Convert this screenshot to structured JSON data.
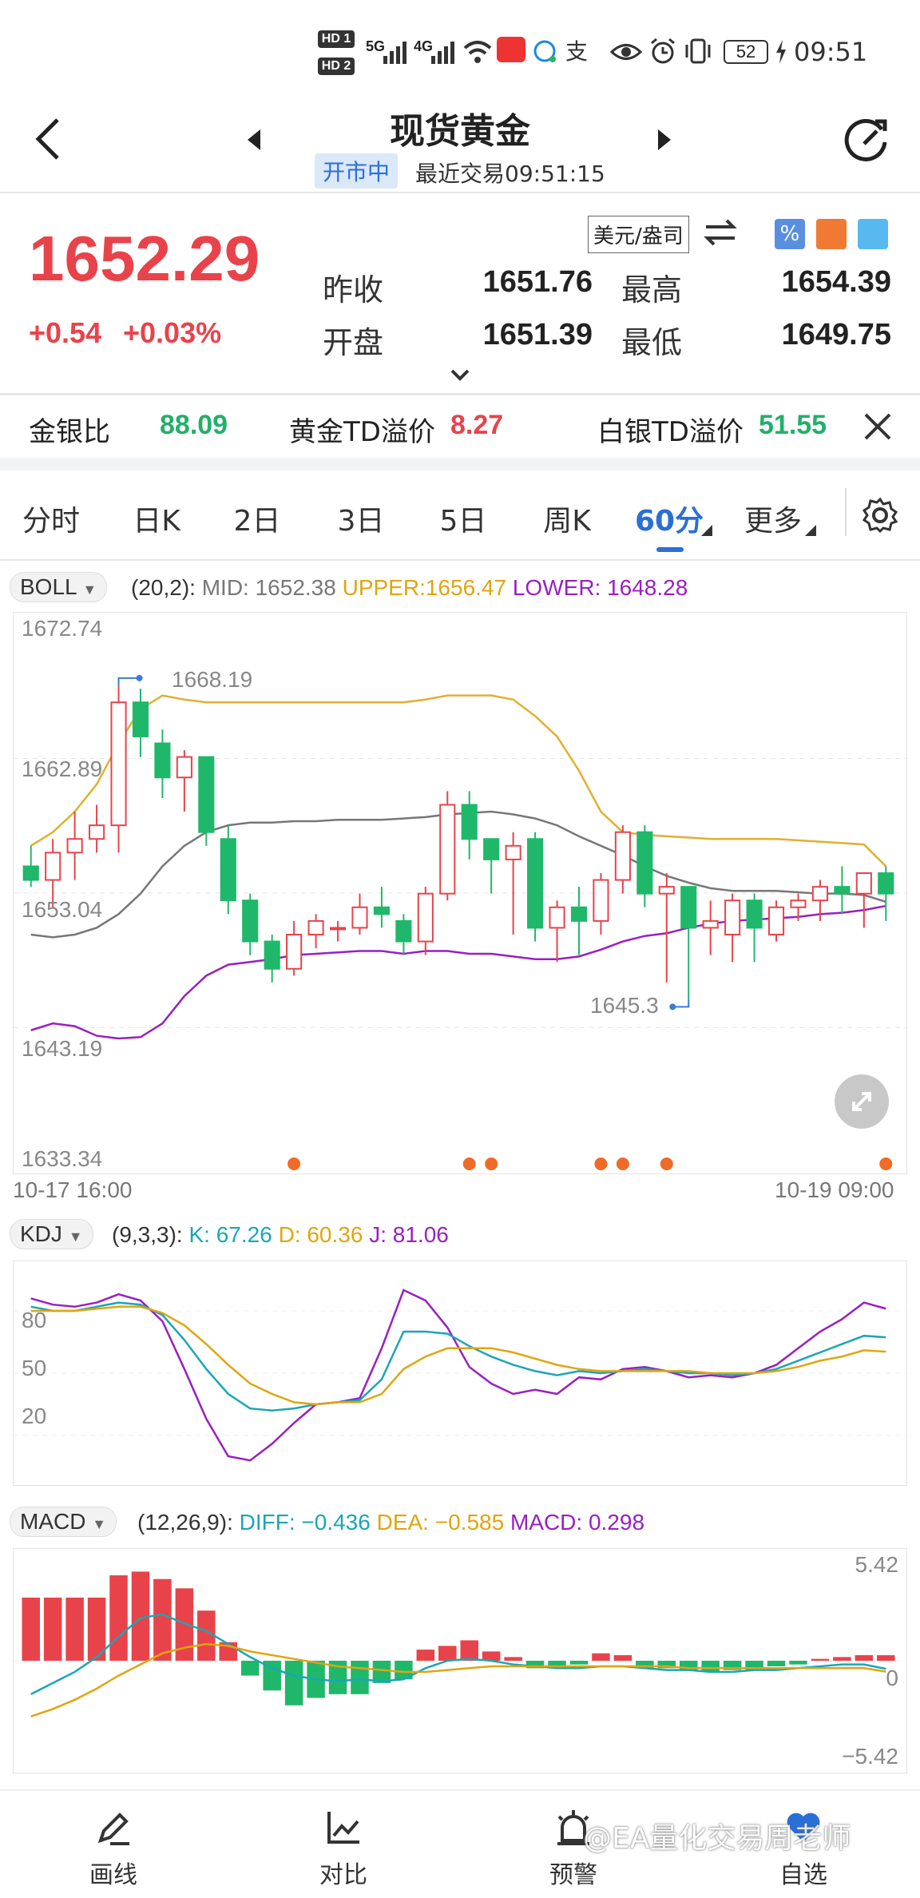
{
  "status_bar": {
    "hd1": "HD 1",
    "hd2": "HD 2",
    "net1": "5G",
    "net2": "4G",
    "battery": "52",
    "time": "09:51"
  },
  "header": {
    "title": "现货黄金",
    "status_badge": "开市中",
    "last_trade": "最近交易09:51:15"
  },
  "quote": {
    "price": "1652.29",
    "change": "+0.54",
    "change_pct": "+0.03%",
    "currency_unit": "美元/盎司",
    "fields": [
      {
        "label": "昨收",
        "value": "1651.76"
      },
      {
        "label": "最高",
        "value": "1654.39"
      },
      {
        "label": "开盘",
        "value": "1651.39"
      },
      {
        "label": "最低",
        "value": "1649.75"
      }
    ]
  },
  "ratios": {
    "gold_silver_label": "金银比",
    "gold_silver_value": "88.09",
    "gold_td_label": "黄金TD溢价",
    "gold_td_value": "8.27",
    "silver_td_label": "白银TD溢价",
    "silver_td_value": "51.55"
  },
  "tabs": [
    "分时",
    "日K",
    "2日",
    "3日",
    "5日",
    "周K",
    "60分",
    "更多"
  ],
  "active_tab": "60分",
  "boll": {
    "name": "BOLL",
    "params": "(20,2):",
    "mid": "MID: 1652.38",
    "upper": "UPPER:1656.47",
    "lower": "LOWER: 1648.28"
  },
  "kdj": {
    "name": "KDJ",
    "params": "(9,3,3):",
    "k": "K: 67.26",
    "d": "D: 60.36",
    "j": "J: 81.06",
    "y_ticks": [
      "80",
      "50",
      "20"
    ]
  },
  "macd": {
    "name": "MACD",
    "params": "(12,26,9):",
    "diff": "DIFF: −0.436",
    "dea": "DEA: −0.585",
    "macd": "MACD: 0.298",
    "y_top": "5.42",
    "y_mid": "0",
    "y_bottom": "−5.42"
  },
  "colors": {
    "up": "#e8434b",
    "down": "#1fb86a",
    "accent": "#2a6fd6",
    "upper_band": "#e0b030",
    "lower_band": "#9a1fc0",
    "mid_band": "#777777"
  },
  "chart_data": {
    "type": "candlestick",
    "title": "",
    "y_ticks": [
      "1672.74",
      "1662.89",
      "1653.04",
      "1643.19",
      "1633.34"
    ],
    "ylim": [
      1633.34,
      1672.74
    ],
    "x_start_label": "10-17 16:00",
    "x_end_label": "10-19 09:00",
    "max_annotation": "1668.19",
    "min_annotation": "1645.3",
    "candles": [
      {
        "o": 1655.0,
        "h": 1656.5,
        "l": 1653.5,
        "c": 1654.0
      },
      {
        "o": 1654.0,
        "h": 1657.0,
        "l": 1652.0,
        "c": 1656.0
      },
      {
        "o": 1656.0,
        "h": 1659.0,
        "l": 1654.0,
        "c": 1657.0
      },
      {
        "o": 1657.0,
        "h": 1659.5,
        "l": 1656.0,
        "c": 1658.0
      },
      {
        "o": 1658.0,
        "h": 1668.19,
        "l": 1656.0,
        "c": 1667.0
      },
      {
        "o": 1667.0,
        "h": 1668.0,
        "l": 1663.0,
        "c": 1664.5
      },
      {
        "o": 1664.0,
        "h": 1665.0,
        "l": 1660.0,
        "c": 1661.5
      },
      {
        "o": 1661.5,
        "h": 1663.5,
        "l": 1659.0,
        "c": 1663.0
      },
      {
        "o": 1663.0,
        "h": 1663.0,
        "l": 1656.5,
        "c": 1657.5
      },
      {
        "o": 1657.0,
        "h": 1658.0,
        "l": 1651.5,
        "c": 1652.5
      },
      {
        "o": 1652.5,
        "h": 1653.0,
        "l": 1648.5,
        "c": 1649.5
      },
      {
        "o": 1649.5,
        "h": 1650.0,
        "l": 1646.5,
        "c": 1647.5
      },
      {
        "o": 1647.5,
        "h": 1651.0,
        "l": 1647.0,
        "c": 1650.0
      },
      {
        "o": 1650.0,
        "h": 1651.5,
        "l": 1649.0,
        "c": 1651.0
      },
      {
        "o": 1650.5,
        "h": 1651.0,
        "l": 1649.5,
        "c": 1650.5
      },
      {
        "o": 1650.5,
        "h": 1653.0,
        "l": 1650.0,
        "c": 1652.0
      },
      {
        "o": 1652.0,
        "h": 1653.5,
        "l": 1650.5,
        "c": 1651.5
      },
      {
        "o": 1651.0,
        "h": 1651.5,
        "l": 1648.5,
        "c": 1649.5
      },
      {
        "o": 1649.5,
        "h": 1653.5,
        "l": 1648.5,
        "c": 1653.0
      },
      {
        "o": 1653.0,
        "h": 1660.5,
        "l": 1652.5,
        "c": 1659.5
      },
      {
        "o": 1659.5,
        "h": 1660.5,
        "l": 1655.5,
        "c": 1657.0
      },
      {
        "o": 1657.0,
        "h": 1657.0,
        "l": 1653.0,
        "c": 1655.5
      },
      {
        "o": 1655.5,
        "h": 1657.5,
        "l": 1650.0,
        "c": 1656.5
      },
      {
        "o": 1657.0,
        "h": 1657.5,
        "l": 1649.5,
        "c": 1650.5
      },
      {
        "o": 1650.5,
        "h": 1652.5,
        "l": 1648.0,
        "c": 1652.0
      },
      {
        "o": 1652.0,
        "h": 1653.5,
        "l": 1648.5,
        "c": 1651.0
      },
      {
        "o": 1651.0,
        "h": 1654.5,
        "l": 1650.0,
        "c": 1654.0
      },
      {
        "o": 1654.0,
        "h": 1658.0,
        "l": 1653.0,
        "c": 1657.5
      },
      {
        "o": 1657.5,
        "h": 1658.0,
        "l": 1652.0,
        "c": 1653.0
      },
      {
        "o": 1653.0,
        "h": 1654.5,
        "l": 1646.5,
        "c": 1653.5
      },
      {
        "o": 1653.5,
        "h": 1653.5,
        "l": 1645.3,
        "c": 1650.5
      },
      {
        "o": 1650.5,
        "h": 1652.5,
        "l": 1648.5,
        "c": 1651.0
      },
      {
        "o": 1650.0,
        "h": 1653.0,
        "l": 1648.0,
        "c": 1652.5
      },
      {
        "o": 1652.5,
        "h": 1653.0,
        "l": 1648.0,
        "c": 1650.5
      },
      {
        "o": 1650.0,
        "h": 1652.5,
        "l": 1649.5,
        "c": 1652.0
      },
      {
        "o": 1652.0,
        "h": 1653.0,
        "l": 1651.0,
        "c": 1652.5
      },
      {
        "o": 1652.5,
        "h": 1654.0,
        "l": 1651.0,
        "c": 1653.5
      },
      {
        "o": 1653.5,
        "h": 1655.0,
        "l": 1651.5,
        "c": 1653.0
      },
      {
        "o": 1653.0,
        "h": 1654.5,
        "l": 1650.5,
        "c": 1654.5
      },
      {
        "o": 1654.5,
        "h": 1655.0,
        "l": 1651.0,
        "c": 1653.0
      }
    ],
    "upper": [
      1656.5,
      1657.5,
      1659,
      1661,
      1664,
      1666.5,
      1667.5,
      1667.2,
      1667,
      1667,
      1667,
      1667,
      1667,
      1667,
      1667,
      1667,
      1667,
      1667,
      1667.2,
      1667.5,
      1667.5,
      1667.5,
      1667.2,
      1666,
      1664.5,
      1662,
      1659,
      1657.5,
      1657.3,
      1657.2,
      1657.1,
      1657,
      1657,
      1657,
      1657,
      1656.9,
      1656.8,
      1656.7,
      1656.6,
      1655
    ],
    "mid": [
      1650,
      1649.8,
      1650,
      1650.5,
      1651.5,
      1653,
      1655,
      1656.5,
      1657.5,
      1658,
      1658.2,
      1658.2,
      1658.3,
      1658.3,
      1658.4,
      1658.4,
      1658.4,
      1658.5,
      1658.6,
      1658.8,
      1658.9,
      1659,
      1658.8,
      1658.5,
      1658,
      1657.2,
      1656.5,
      1655.8,
      1655,
      1654.3,
      1653.8,
      1653.4,
      1653.2,
      1653.2,
      1653.2,
      1653.1,
      1653,
      1653,
      1652.9,
      1652.4
    ],
    "lower": [
      1643,
      1643.5,
      1643.3,
      1642.6,
      1642.4,
      1642.5,
      1643.5,
      1645.5,
      1647,
      1647.8,
      1648,
      1648.2,
      1648.5,
      1648.6,
      1648.7,
      1648.8,
      1648.8,
      1648.6,
      1648.8,
      1648.8,
      1648.6,
      1648.6,
      1648.4,
      1648.2,
      1648.2,
      1648.4,
      1648.9,
      1649.5,
      1649.9,
      1650.1,
      1650.5,
      1650.8,
      1651,
      1651.1,
      1651.2,
      1651.3,
      1651.5,
      1651.6,
      1651.8,
      1652.1
    ],
    "markers": [
      12,
      20,
      21,
      26,
      27,
      29,
      39
    ],
    "kdj_range": [
      0,
      100
    ],
    "kdj_k": [
      82,
      80,
      80,
      82,
      84,
      83,
      78,
      66,
      52,
      40,
      33,
      32,
      33,
      35,
      36,
      37,
      47,
      70,
      70,
      69,
      63,
      58,
      54,
      51,
      49,
      51,
      50,
      51,
      52,
      51,
      50,
      50,
      49,
      50,
      52,
      56,
      60,
      64,
      68,
      67.26
    ],
    "kdj_d": [
      80,
      80,
      80,
      81,
      82,
      82,
      79,
      73,
      64,
      54,
      45,
      40,
      36,
      35,
      36,
      36,
      40,
      52,
      58,
      62,
      62,
      62,
      60,
      57,
      54,
      52,
      51,
      51,
      51,
      51,
      51,
      50,
      50,
      50,
      51,
      53,
      56,
      58,
      61,
      60.36
    ],
    "kdj_j": [
      86,
      83,
      82,
      84,
      88,
      85,
      75,
      52,
      28,
      10,
      8,
      16,
      26,
      35,
      36,
      38,
      62,
      90,
      85,
      72,
      53,
      45,
      40,
      42,
      40,
      48,
      47,
      52,
      53,
      51,
      48,
      49,
      48,
      50,
      54,
      62,
      70,
      76,
      84,
      81.06
    ],
    "macd_range": [
      -5.42,
      5.42
    ],
    "macd_hist": [
      3.4,
      3.4,
      3.4,
      3.4,
      4.6,
      4.8,
      4.4,
      3.9,
      2.7,
      1.0,
      -0.8,
      -1.6,
      -2.4,
      -2.0,
      -1.8,
      -1.8,
      -1.2,
      -1.0,
      0.6,
      0.8,
      1.1,
      0.5,
      0.2,
      -0.4,
      -0.3,
      -0.2,
      0.4,
      0.3,
      -0.4,
      -0.4,
      -0.5,
      -0.6,
      -0.5,
      -0.5,
      -0.3,
      -0.2,
      0.1,
      0.2,
      0.3,
      0.298
    ],
    "macd_diff": [
      -1.8,
      -1.2,
      -0.6,
      0.2,
      1.3,
      2.3,
      2.5,
      2.0,
      1.6,
      0.9,
      0.2,
      -0.4,
      -0.8,
      -1.0,
      -1.1,
      -1.0,
      -1.1,
      -1.0,
      -0.4,
      0.0,
      0.1,
      0.0,
      -0.2,
      -0.3,
      -0.4,
      -0.4,
      -0.3,
      -0.3,
      -0.4,
      -0.5,
      -0.5,
      -0.6,
      -0.6,
      -0.5,
      -0.5,
      -0.4,
      -0.3,
      -0.2,
      -0.2,
      -0.436
    ],
    "macd_dea": [
      -3.0,
      -2.6,
      -2.1,
      -1.5,
      -0.8,
      -0.2,
      0.4,
      0.7,
      0.9,
      0.8,
      0.5,
      0.3,
      0.1,
      -0.1,
      -0.3,
      -0.4,
      -0.5,
      -0.6,
      -0.6,
      -0.5,
      -0.4,
      -0.3,
      -0.3,
      -0.3,
      -0.3,
      -0.3,
      -0.3,
      -0.3,
      -0.3,
      -0.3,
      -0.4,
      -0.4,
      -0.4,
      -0.4,
      -0.4,
      -0.4,
      -0.4,
      -0.4,
      -0.4,
      -0.585
    ]
  },
  "bottom_nav": [
    {
      "label": "画线",
      "icon": "pencil-icon"
    },
    {
      "label": "对比",
      "icon": "compare-chart-icon"
    },
    {
      "label": "预警",
      "icon": "alarm-icon"
    },
    {
      "label": "自选",
      "icon": "heart-icon"
    }
  ],
  "watermark": "@EA量化交易周老师"
}
